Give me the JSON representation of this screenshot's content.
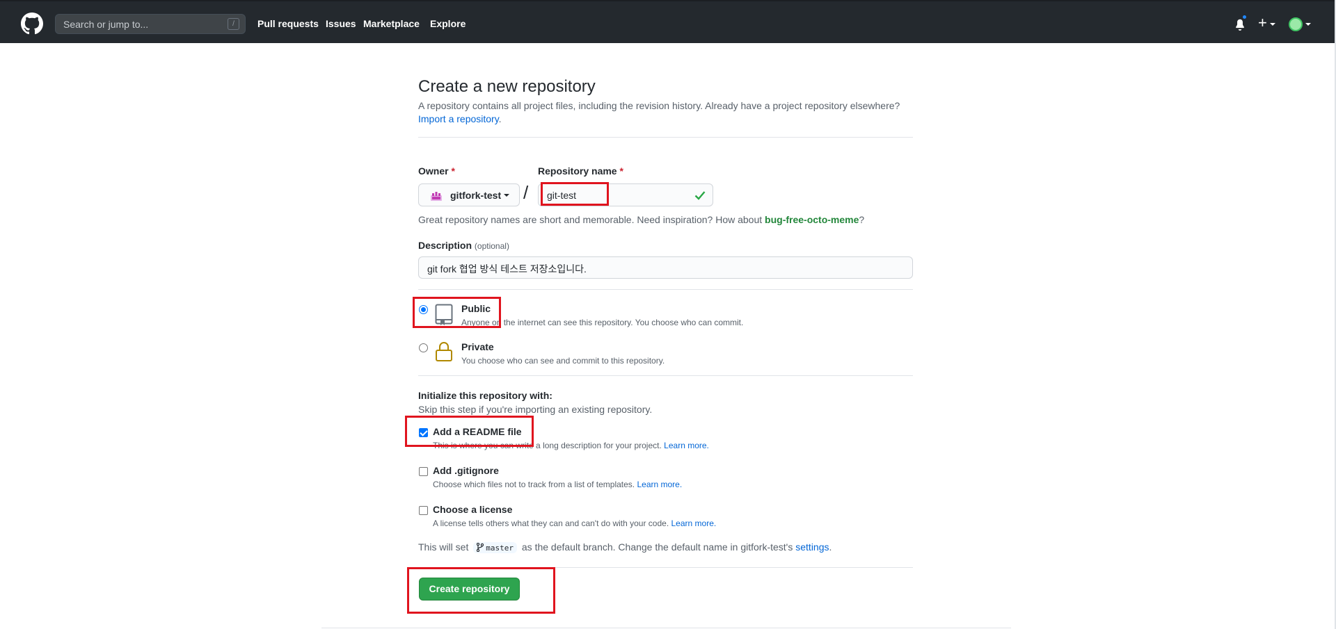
{
  "header": {
    "search_placeholder": "Search or jump to...",
    "search_shortcut": "/",
    "nav": [
      "Pull requests",
      "Issues",
      "Marketplace",
      "Explore"
    ],
    "plus_label": "+"
  },
  "page": {
    "title": "Create a new repository",
    "subtitle": "A repository contains all project files, including the revision history. Already have a project repository elsewhere?",
    "import_link": "Import a repository",
    "import_suffix": "."
  },
  "form": {
    "owner_label": "Owner",
    "required_mark": "*",
    "owner_value": "gitfork-test",
    "slash": "/",
    "repo_label": "Repository name",
    "repo_value": "git-test",
    "hint_prefix": "Great repository names are short and memorable. Need inspiration? How about ",
    "hint_suggestion": "bug-free-octo-meme",
    "hint_suffix": "?",
    "desc_label": "Description",
    "desc_optional": "(optional)",
    "desc_value": "git fork 협업 방식 테스트 저장소입니다."
  },
  "visibility": {
    "public_title": "Public",
    "public_desc": "Anyone on the internet can see this repository. You choose who can commit.",
    "public_selected": true,
    "private_title": "Private",
    "private_desc": "You choose who can see and commit to this repository."
  },
  "init": {
    "title": "Initialize this repository with:",
    "subtitle": "Skip this step if you're importing an existing repository.",
    "readme_title": "Add a README file",
    "readme_desc": "This is where you can write a long description for your project.",
    "readme_checked": true,
    "gitignore_title": "Add .gitignore",
    "gitignore_desc": "Choose which files not to track from a list of templates.",
    "license_title": "Choose a license",
    "license_desc": "A license tells others what they can and can't do with your code.",
    "learn_more": "Learn more."
  },
  "branch": {
    "prefix": "This will set",
    "branch_name": "master",
    "middle": "as the default branch. Change the default name in gitfork-test's",
    "settings_link": "settings",
    "suffix": "."
  },
  "submit": {
    "label": "Create repository"
  },
  "colors": {
    "header_bg": "#24292e",
    "primary_button": "#2ea44f",
    "link": "#0366d6",
    "highlight": "#e0141e"
  }
}
